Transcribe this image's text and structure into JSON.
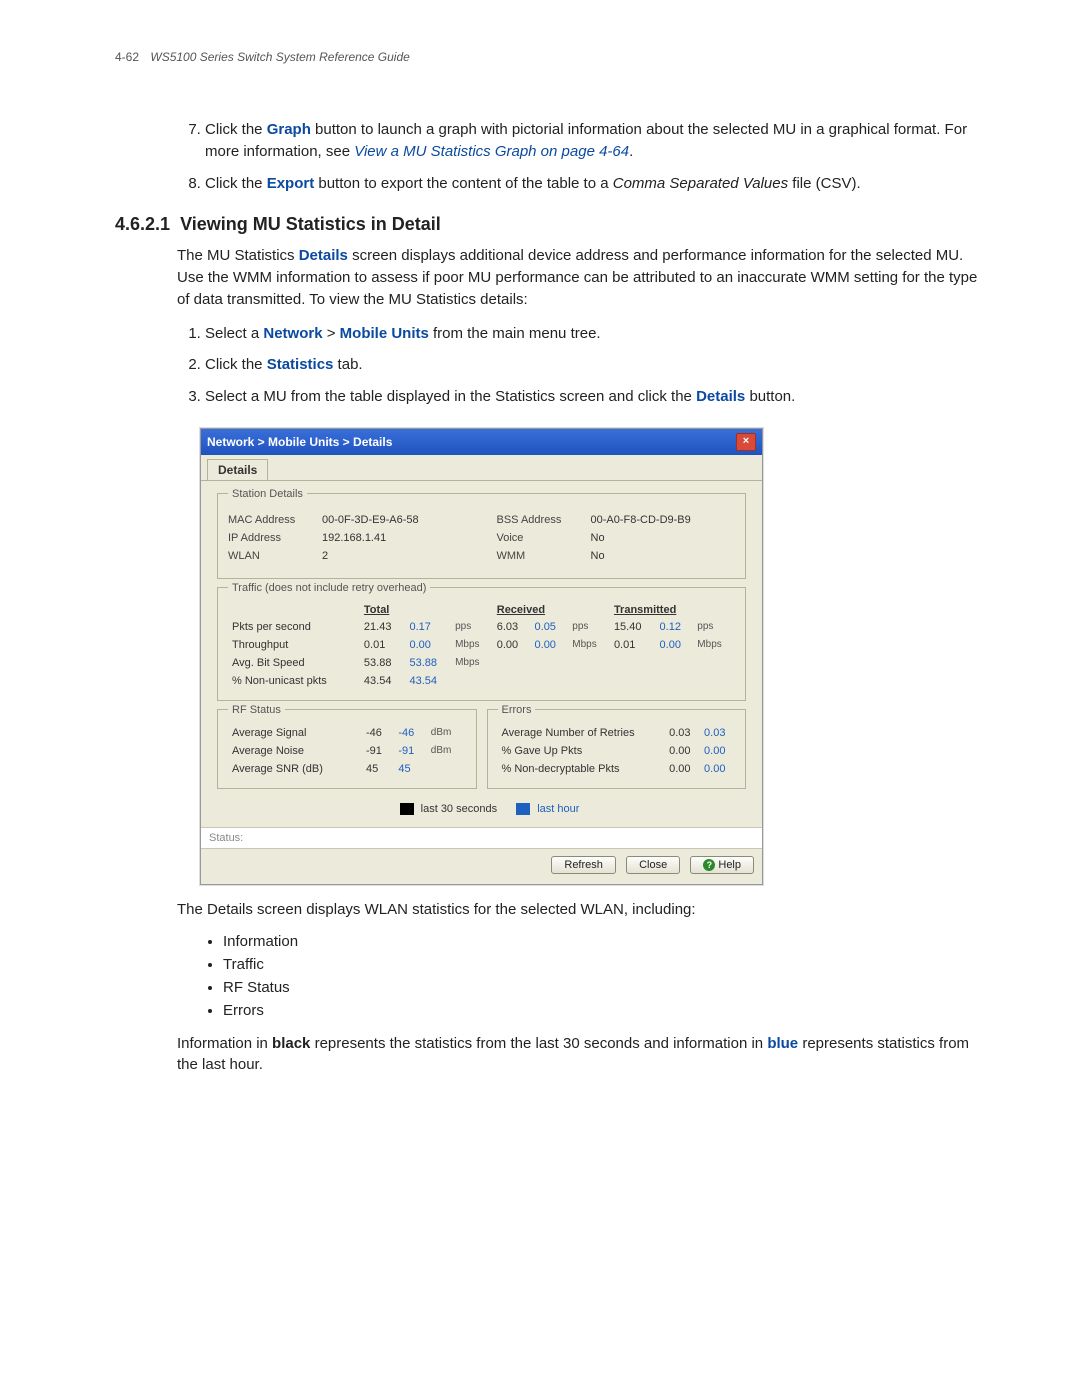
{
  "header": {
    "pagenum": "4-62",
    "guide": "WS5100 Series Switch System Reference Guide"
  },
  "top_steps": {
    "step7": {
      "pre": "Click the ",
      "kw": "Graph",
      "mid": " button to launch a graph with pictorial information about the selected MU in a graphical format. For more information, see ",
      "link": "View a MU Statistics Graph on page 4-64",
      "post": "."
    },
    "step8": {
      "pre": "Click the ",
      "kw": "Export",
      "mid": " button to export the content of the table to a ",
      "ital": "Comma Separated Values",
      "post": " file (CSV)."
    }
  },
  "section": {
    "num": "4.6.2.1",
    "title": "Viewing MU Statistics in Detail",
    "intro_pre": "The MU Statistics ",
    "intro_kw": "Details",
    "intro_post": " screen displays additional device address and performance information for the selected MU. Use the WMM information to assess if poor MU performance can be attributed to an inaccurate WMM setting for the type of data transmitted. To view the MU Statistics details:",
    "steps": {
      "s1_pre": "Select a ",
      "s1_k1": "Network",
      "s1_gt": " > ",
      "s1_k2": "Mobile Units",
      "s1_post": " from the main menu tree.",
      "s2_pre": "Click the ",
      "s2_k": "Statistics",
      "s2_post": " tab.",
      "s3_pre": "Select a MU from the table displayed in the Statistics screen and click the ",
      "s3_k": "Details",
      "s3_post": " button."
    }
  },
  "dialog": {
    "title": "Network > Mobile Units > Details",
    "tab": "Details",
    "station_legend": "Station Details",
    "station": {
      "mac_l": "MAC Address",
      "mac_v": "00-0F-3D-E9-A6-58",
      "ip_l": "IP Address",
      "ip_v": "192.168.1.41",
      "wlan_l": "WLAN",
      "wlan_v": "2",
      "bss_l": "BSS Address",
      "bss_v": "00-A0-F8-CD-D9-B9",
      "voice_l": "Voice",
      "voice_v": "No",
      "wmm_l": "WMM",
      "wmm_v": "No"
    },
    "traffic_legend": "Traffic (does not include retry overhead)",
    "cols": {
      "total": "Total",
      "recv": "Received",
      "trans": "Transmitted"
    },
    "traffic": {
      "r1_l": "Pkts per second",
      "r1_t1": "21.43",
      "r1_t2": "0.17",
      "r1_u": "pps",
      "r1_r1": "6.03",
      "r1_r2": "0.05",
      "r1_x1": "15.40",
      "r1_x2": "0.12",
      "r2_l": "Throughput",
      "r2_t1": "0.01",
      "r2_t2": "0.00",
      "r2_u": "Mbps",
      "r2_r1": "0.00",
      "r2_r2": "0.00",
      "r2_x1": "0.01",
      "r2_x2": "0.00",
      "r3_l": "Avg. Bit Speed",
      "r3_t1": "53.88",
      "r3_t2": "53.88",
      "r3_u": "Mbps",
      "r4_l": "% Non-unicast pkts",
      "r4_t1": "43.54",
      "r4_t2": "43.54"
    },
    "rf_legend": "RF Status",
    "rf": {
      "sig_l": "Average Signal",
      "sig_v1": "-46",
      "sig_v2": "-46",
      "sig_u": "dBm",
      "noise_l": "Average Noise",
      "noise_v1": "-91",
      "noise_v2": "-91",
      "noise_u": "dBm",
      "snr_l": "Average SNR (dB)",
      "snr_v1": "45",
      "snr_v2": "45"
    },
    "err_legend": "Errors",
    "err": {
      "retry_l": "Average Number of Retries",
      "retry_v1": "0.03",
      "retry_v2": "0.03",
      "gave_l": "% Gave Up Pkts",
      "gave_v1": "0.00",
      "gave_v2": "0.00",
      "nondec_l": "% Non-decryptable Pkts",
      "nondec_v1": "0.00",
      "nondec_v2": "0.00"
    },
    "legend30": "last 30 seconds",
    "legendHr": "last hour",
    "status_label": "Status:",
    "btn_refresh": "Refresh",
    "btn_close": "Close",
    "btn_help": "Help"
  },
  "after": {
    "p1": "The Details screen displays WLAN statistics for the selected WLAN, including:",
    "b1": "Information",
    "b2": "Traffic",
    "b3": "RF Status",
    "b4": "Errors",
    "p2_pre": "Information in ",
    "p2_k1": "black",
    "p2_mid": " represents the statistics from the last 30 seconds and information in ",
    "p2_k2": "blue",
    "p2_post": " represents statistics from the last hour."
  }
}
